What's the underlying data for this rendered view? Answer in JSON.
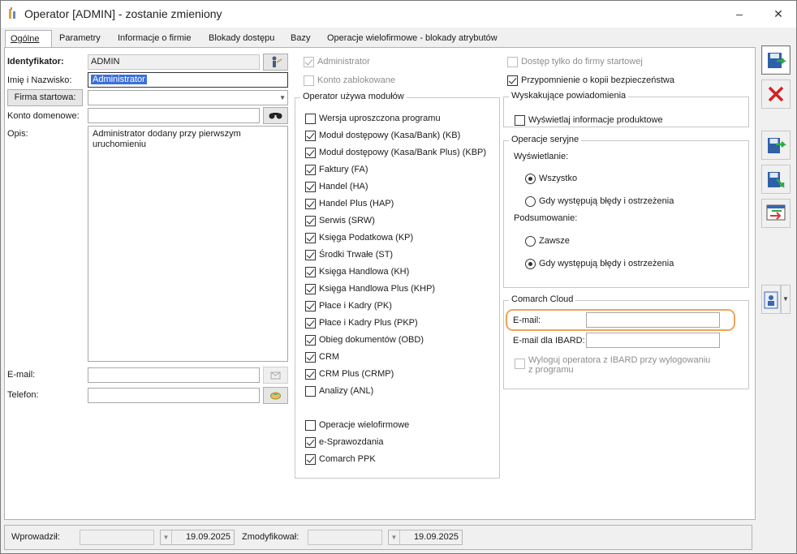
{
  "window": {
    "title": "Operator [ADMIN] - zostanie zmieniony",
    "minimize": "–",
    "close": "✕"
  },
  "tabs": [
    {
      "label": "Ogólne"
    },
    {
      "label": "Parametry"
    },
    {
      "label": "Informacje o firmie"
    },
    {
      "label": "Blokady dostępu"
    },
    {
      "label": "Bazy"
    },
    {
      "label": "Operacje wielofirmowe - blokady atrybutów"
    }
  ],
  "left": {
    "identyfikator_label": "Identyfikator:",
    "identyfikator_value": "ADMIN",
    "imie_label": "Imię i Nazwisko:",
    "imie_value": "Administrator",
    "firma_button": "Firma startowa:",
    "firma_value": "",
    "konto_label": "Konto domenowe:",
    "konto_value": "",
    "opis_label": "Opis:",
    "opis_value": "Administrator dodany przy pierwszym uruchomieniu",
    "email_label": "E-mail:",
    "email_value": "",
    "telefon_label": "Telefon:",
    "telefon_value": ""
  },
  "middle": {
    "administrator": "Administrator",
    "konto_zablokowane": "Konto zablokowane",
    "group_title": "Operator używa modułów",
    "modules": [
      {
        "label": "Wersja uproszczona programu",
        "checked": false
      },
      {
        "label": "Moduł dostępowy (Kasa/Bank) (KB)",
        "checked": true
      },
      {
        "label": "Moduł dostępowy (Kasa/Bank Plus) (KBP)",
        "checked": true
      },
      {
        "label": "Faktury (FA)",
        "checked": true
      },
      {
        "label": "Handel (HA)",
        "checked": true
      },
      {
        "label": "Handel Plus (HAP)",
        "checked": true
      },
      {
        "label": "Serwis (SRW)",
        "checked": true
      },
      {
        "label": "Księga Podatkowa (KP)",
        "checked": true
      },
      {
        "label": "Środki Trwałe (ST)",
        "checked": true
      },
      {
        "label": "Księga Handlowa (KH)",
        "checked": true
      },
      {
        "label": "Księga Handlowa Plus (KHP)",
        "checked": true
      },
      {
        "label": "Płace i Kadry (PK)",
        "checked": true
      },
      {
        "label": "Płace i Kadry Plus (PKP)",
        "checked": true
      },
      {
        "label": "Obieg dokumentów (OBD)",
        "checked": true
      },
      {
        "label": "CRM",
        "checked": true
      },
      {
        "label": "CRM Plus (CRMP)",
        "checked": true
      },
      {
        "label": "Analizy (ANL)",
        "checked": false
      }
    ],
    "extra": [
      {
        "label": "Operacje wielofirmowe",
        "checked": false
      },
      {
        "label": "e-Sprawozdania",
        "checked": true
      },
      {
        "label": "Comarch PPK",
        "checked": true
      }
    ]
  },
  "right": {
    "dostep_tylko": "Dostęp tylko do firmy startowej",
    "przypomnienie": "Przypomnienie o kopii bezpieczeństwa",
    "powiadomienia_title": "Wyskakujące powiadomienia",
    "wyswietlaj": "Wyświetlaj informacje produktowe",
    "seryjne_title": "Operacje seryjne",
    "wyswietlanie_label": "Wyświetlanie:",
    "rb_wszystko": "Wszystko",
    "rb_bledy1": "Gdy występują błędy i ostrzeżenia",
    "podsumowanie_label": "Podsumowanie:",
    "rb_zawsze": "Zawsze",
    "rb_bledy2": "Gdy występują błędy i ostrzeżenia",
    "cloud_title": "Comarch Cloud",
    "cloud_email_label": "E-mail:",
    "cloud_email_value": "",
    "ibard_label": "E-mail dla IBARD:",
    "ibard_value": "",
    "wyloguj": "Wyloguj operatora z IBARD przy wylogowaniu z programu"
  },
  "footer": {
    "wprowadzil_label": "Wprowadził:",
    "wprowadzil_value": "",
    "wprowadzil_date": "19.09.2025",
    "zmodyfikowal_label": "Zmodyfikował:",
    "zmodyfikowal_value": "",
    "zmodyfikowal_date": "19.09.2025"
  },
  "colors": {
    "accent": "#f0a35a",
    "selection": "#3d70d8"
  }
}
